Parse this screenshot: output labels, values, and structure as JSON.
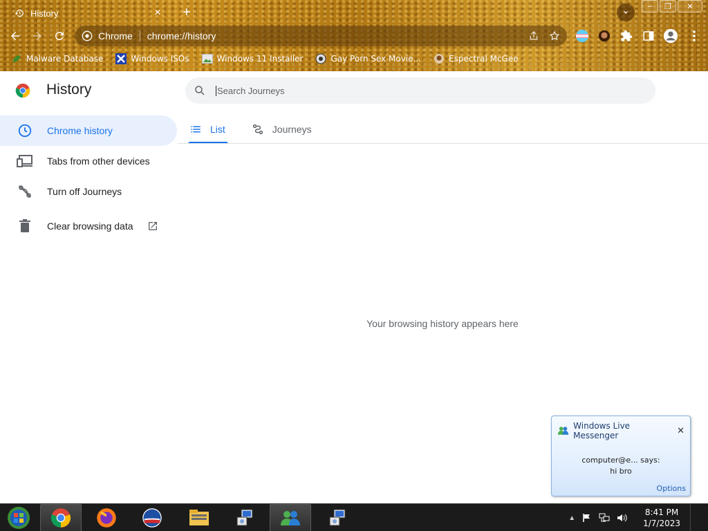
{
  "browser": {
    "tab": {
      "title": "History",
      "close": "×"
    },
    "new_tab": "+",
    "omnibox": {
      "site_label": "Chrome",
      "url": "chrome://history"
    },
    "window_controls": {
      "minimize": "–",
      "restore": "❐",
      "close": "✕"
    },
    "bookmarks": [
      {
        "label": "Malware Database",
        "icon": "leaf-icon"
      },
      {
        "label": "Windows ISOs",
        "icon": "x-logo-icon"
      },
      {
        "label": "Windows 11 Installer",
        "icon": "image-icon"
      },
      {
        "label": "Gay Porn Sex Movie...",
        "icon": "site-icon"
      },
      {
        "label": "Espectral McGee",
        "icon": "avatar-icon"
      }
    ]
  },
  "page": {
    "title": "History",
    "search": {
      "placeholder": "Search Journeys"
    },
    "sidebar": [
      {
        "label": "Chrome history",
        "icon": "clock-icon",
        "active": true
      },
      {
        "label": "Tabs from other devices",
        "icon": "devices-icon",
        "active": false
      },
      {
        "label": "Turn off Journeys",
        "icon": "journeys-off-icon",
        "active": false
      },
      {
        "label": "Clear browsing data",
        "icon": "trash-icon",
        "active": false
      }
    ],
    "tabs": [
      {
        "label": "List",
        "icon": "list-icon",
        "active": true
      },
      {
        "label": "Journeys",
        "icon": "journeys-icon",
        "active": false
      }
    ],
    "empty_message": "Your browsing history appears here"
  },
  "messenger": {
    "title": "Windows Live Messenger",
    "line1": "computer@e... says:",
    "line2": "hi bro",
    "options": "Options"
  },
  "taskbar": {
    "time": "8:41 PM",
    "date": "1/7/2023"
  },
  "colors": {
    "accent": "#1a73e8",
    "active_bg": "#e8f0fe",
    "theme": "#b27813"
  }
}
